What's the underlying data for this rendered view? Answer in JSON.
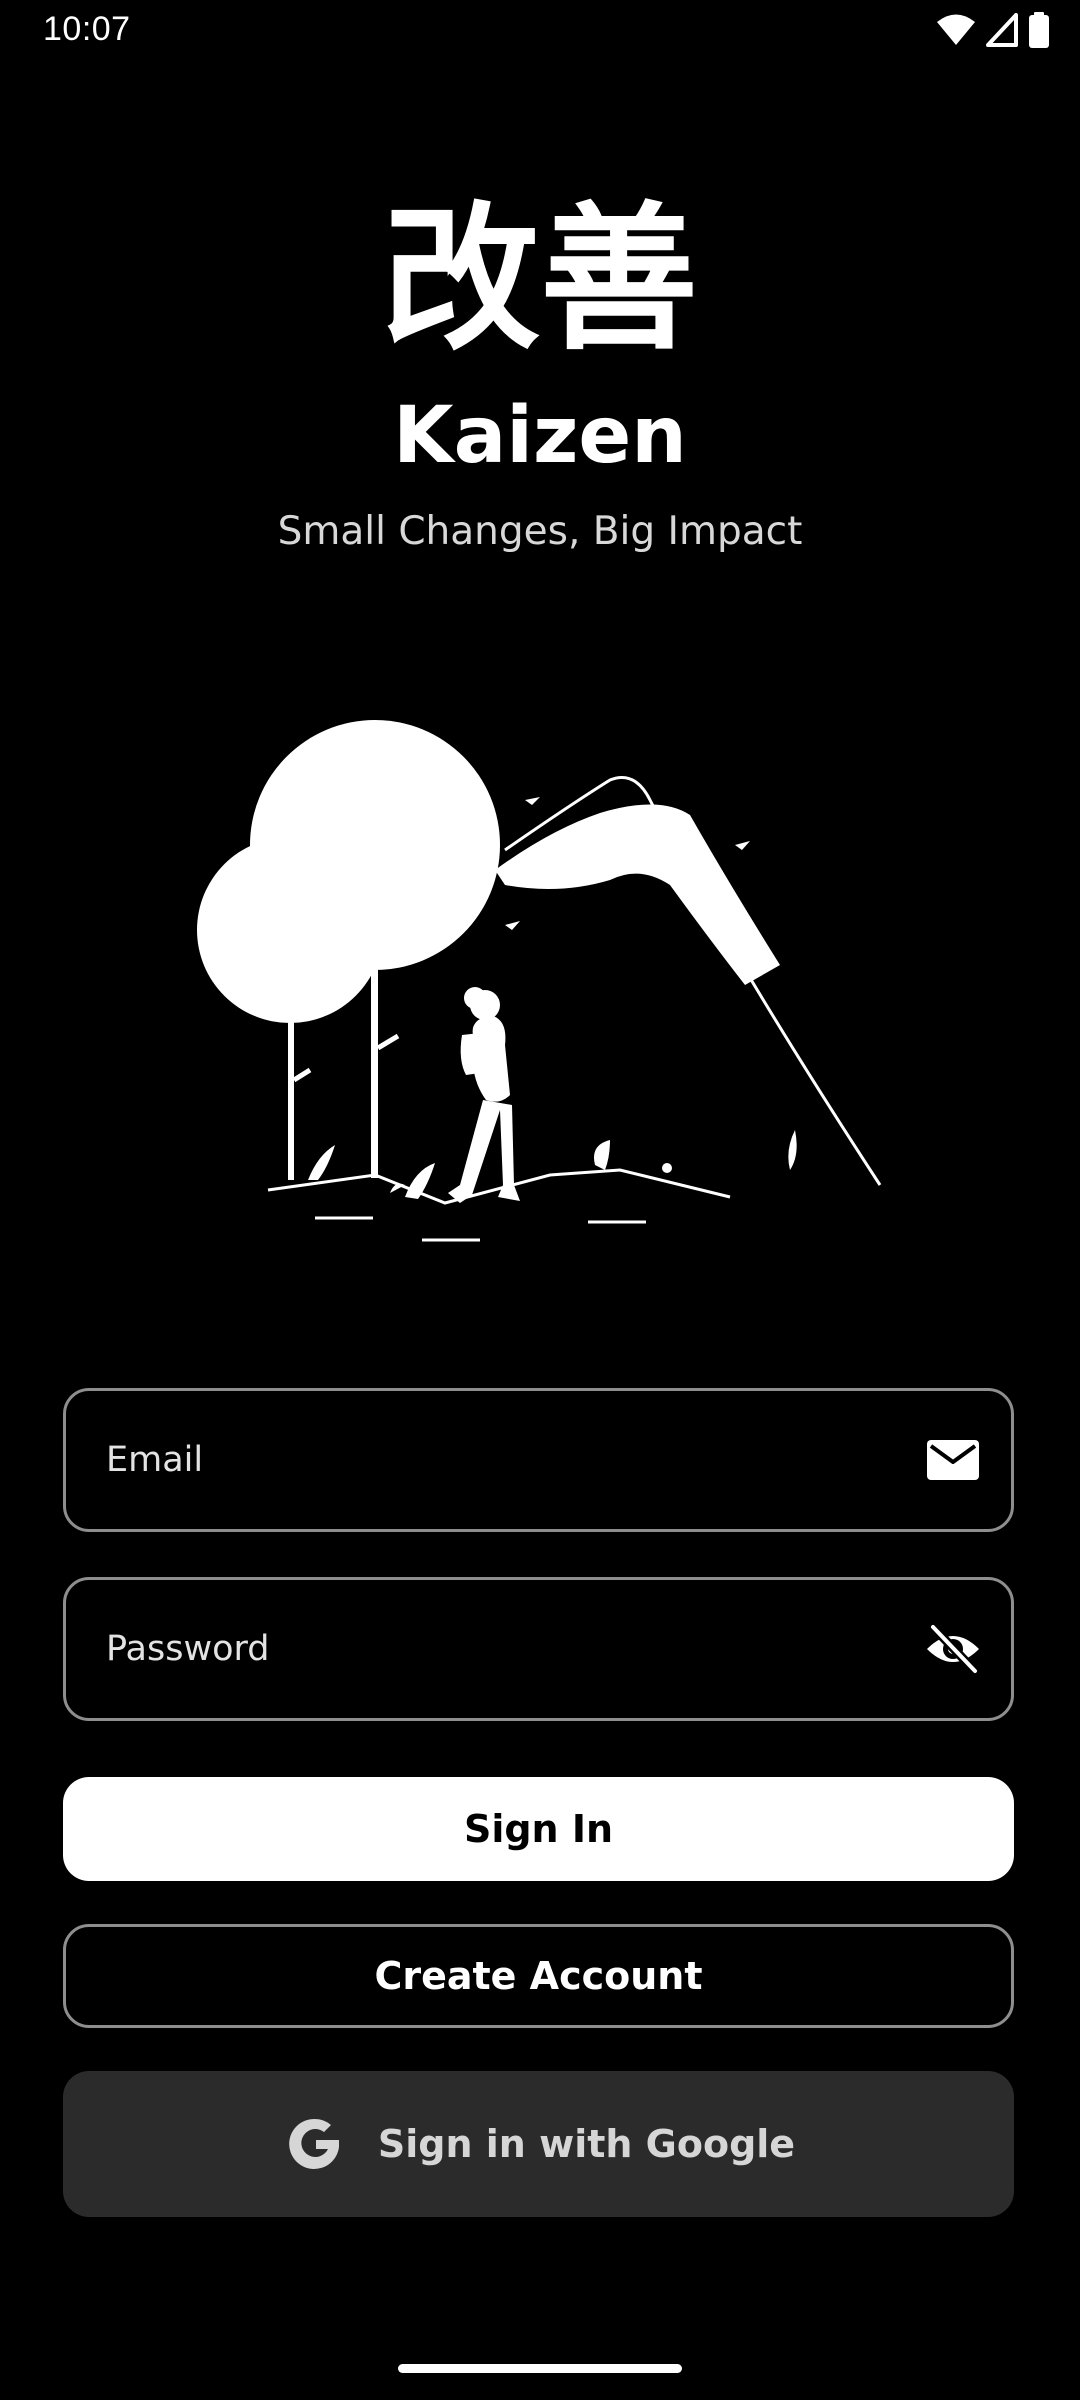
{
  "status_bar": {
    "time": "10:07",
    "icons": [
      "wifi-icon",
      "signal-icon",
      "battery-icon"
    ]
  },
  "logo": {
    "kanji": "改善",
    "app_name": "Kaizen",
    "tagline": "Small Changes, Big Impact"
  },
  "illustration": {
    "description_icon": "hiker-landscape-illustration"
  },
  "form": {
    "email_placeholder": "Email",
    "email_icon": "mail-icon",
    "password_placeholder": "Password",
    "password_icon": "visibility-off-icon"
  },
  "buttons": {
    "sign_in": "Sign In",
    "create_account": "Create Account",
    "google": "Sign in with Google",
    "google_icon": "google-icon"
  },
  "colors": {
    "background": "#000000",
    "primary": "#ffffff",
    "outline": "#8e8e8e",
    "google_button_bg": "#2b2b2b"
  }
}
